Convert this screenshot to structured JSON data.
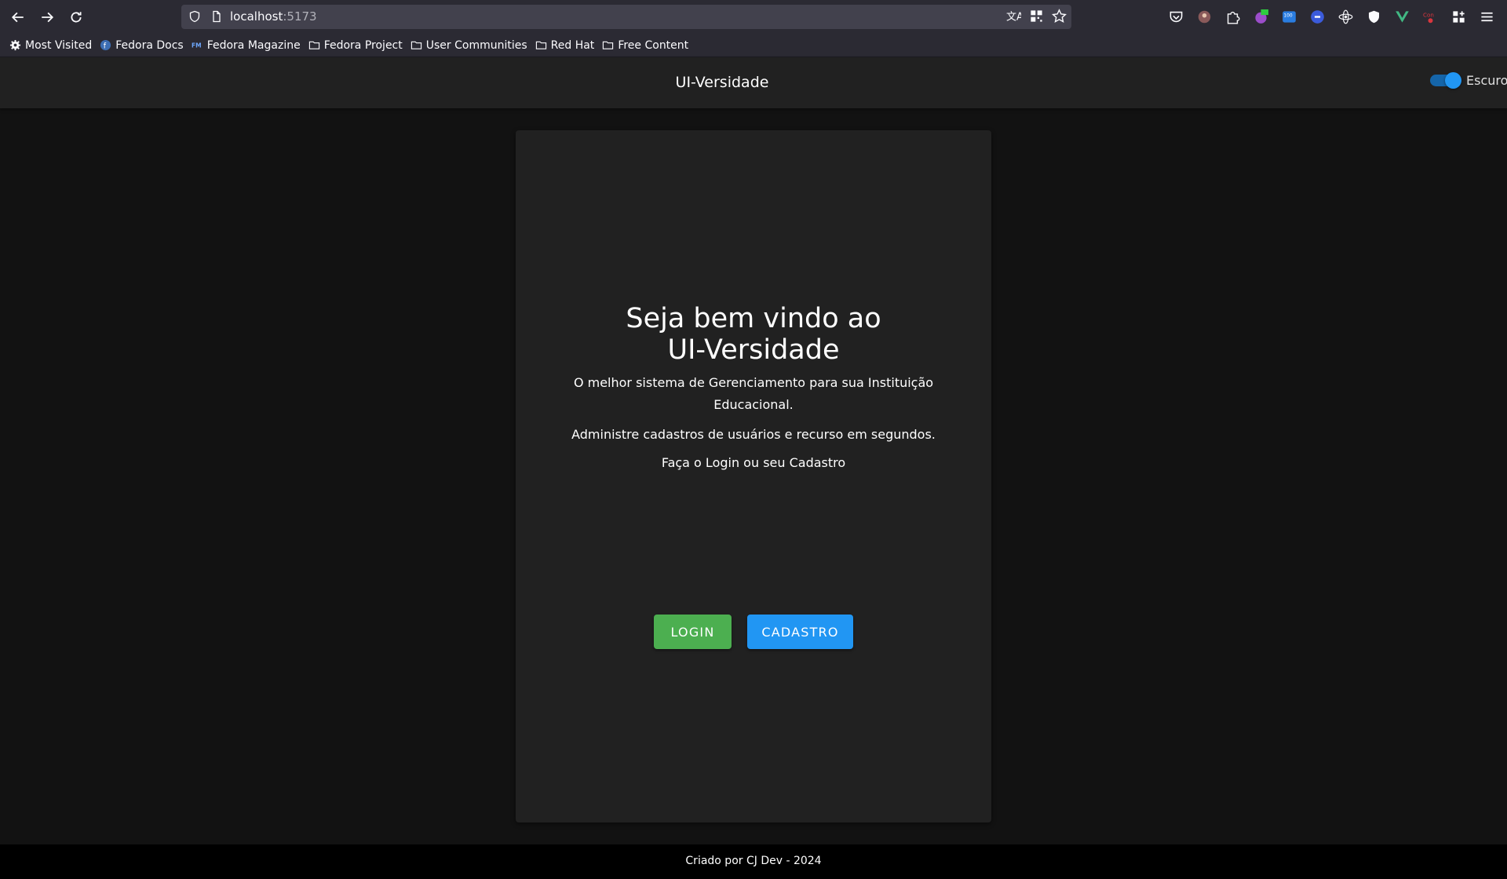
{
  "browser": {
    "url_host": "localhost",
    "url_port": ":5173",
    "bookmarks": [
      {
        "label": "Most Visited",
        "icon": "gear-icon"
      },
      {
        "label": "Fedora Docs",
        "icon": "fedora-icon"
      },
      {
        "label": "Fedora Magazine",
        "icon": "fm-icon"
      },
      {
        "label": "Fedora Project",
        "icon": "folder-icon"
      },
      {
        "label": "User Communities",
        "icon": "folder-icon"
      },
      {
        "label": "Red Hat",
        "icon": "folder-icon"
      },
      {
        "label": "Free Content",
        "icon": "folder-icon"
      }
    ]
  },
  "header": {
    "title": "UI-Versidade",
    "theme_label": "Escuro",
    "theme_dark_enabled": true
  },
  "welcome": {
    "heading_line1": "Seja bem vindo ao",
    "heading_line2": "UI-Versidade",
    "description": "O melhor sistema de Gerenciamento para sua Instituição Educacional.",
    "admin_text": "Administre cadastros de usuários e recurso em segundos.",
    "prompt": "Faça o Login ou seu Cadastro",
    "login_label": "LOGIN",
    "register_label": "CADASTRO"
  },
  "footer": {
    "text": "Criado por CJ Dev - 2024"
  },
  "colors": {
    "login_button": "#4caf50",
    "register_button": "#2196f3",
    "card_background": "#212121",
    "page_background": "#121212"
  }
}
